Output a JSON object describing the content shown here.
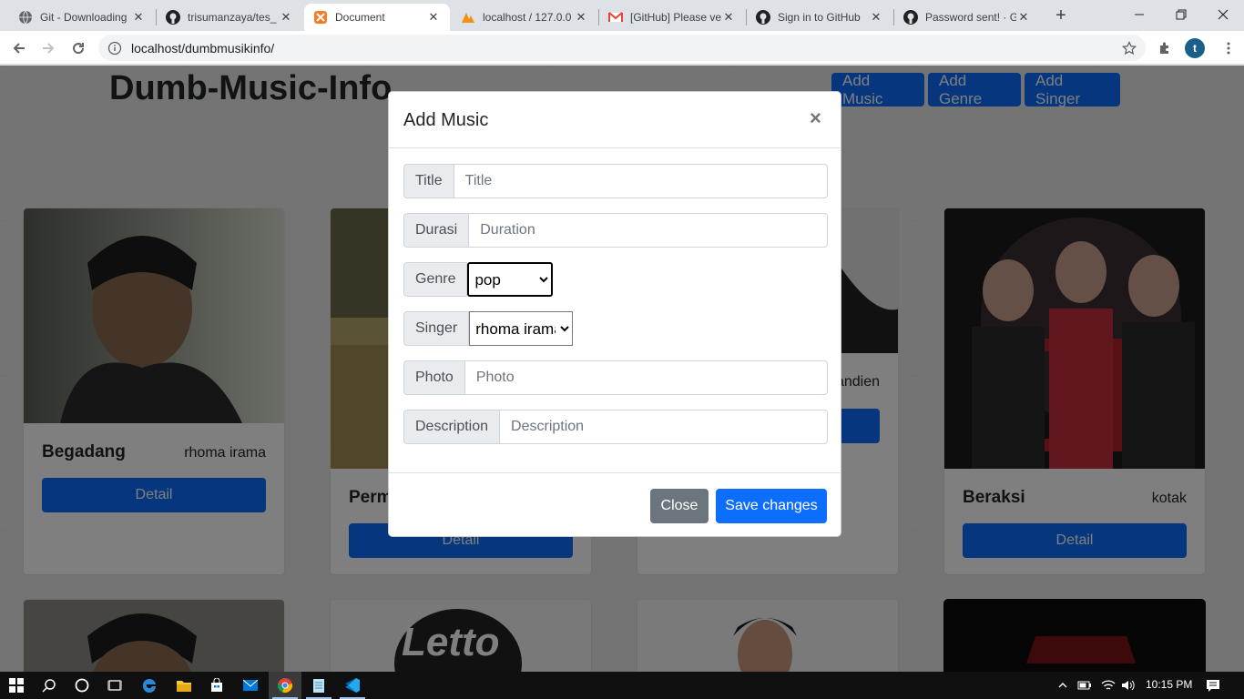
{
  "browser": {
    "tabs": [
      {
        "title": "Git - Downloading",
        "icon": "globe-icon"
      },
      {
        "title": "trisumanzaya/tes_",
        "icon": "github-icon"
      },
      {
        "title": "Document",
        "icon": "xampp-icon"
      },
      {
        "title": "localhost / 127.0.0",
        "icon": "phpmyadmin-icon"
      },
      {
        "title": "[GitHub] Please ve",
        "icon": "gmail-icon"
      },
      {
        "title": "Sign in to GitHub",
        "icon": "github-icon"
      },
      {
        "title": "Password sent! · G",
        "icon": "github-icon"
      }
    ],
    "url": "localhost/dumbmusikinfo/",
    "profile_initial": "t"
  },
  "page": {
    "site_title": "Dumb-Music-Info",
    "nav_buttons": [
      "Add Music",
      "Add Genre",
      "Add Singer"
    ],
    "cards": [
      {
        "title": "Begadang",
        "singer": "rhoma irama",
        "button": "Detail"
      },
      {
        "title": "Perm",
        "singer": "",
        "button": "Detail"
      },
      {
        "title": "",
        "singer": "andien",
        "button": ""
      },
      {
        "title": "Beraksi",
        "singer": "kotak",
        "button": "Detail"
      }
    ],
    "bottom_card_text": "Letto"
  },
  "modal": {
    "title": "Add Music",
    "close_symbol": "×",
    "fields": [
      {
        "label": "Title",
        "placeholder": "Title"
      },
      {
        "label": "Durasi",
        "placeholder": "Duration"
      },
      {
        "label": "Genre",
        "selected": "pop"
      },
      {
        "label": "Singer",
        "selected": "rhoma irama"
      },
      {
        "label": "Photo",
        "placeholder": "Photo"
      },
      {
        "label": "Description",
        "placeholder": "Description"
      }
    ],
    "close_label": "Close",
    "save_label": "Save changes"
  },
  "taskbar": {
    "time": "10:15 PM"
  },
  "colors": {
    "primary": "#0d6efd",
    "secondary": "#6c757d",
    "taskbar": "#101010"
  }
}
